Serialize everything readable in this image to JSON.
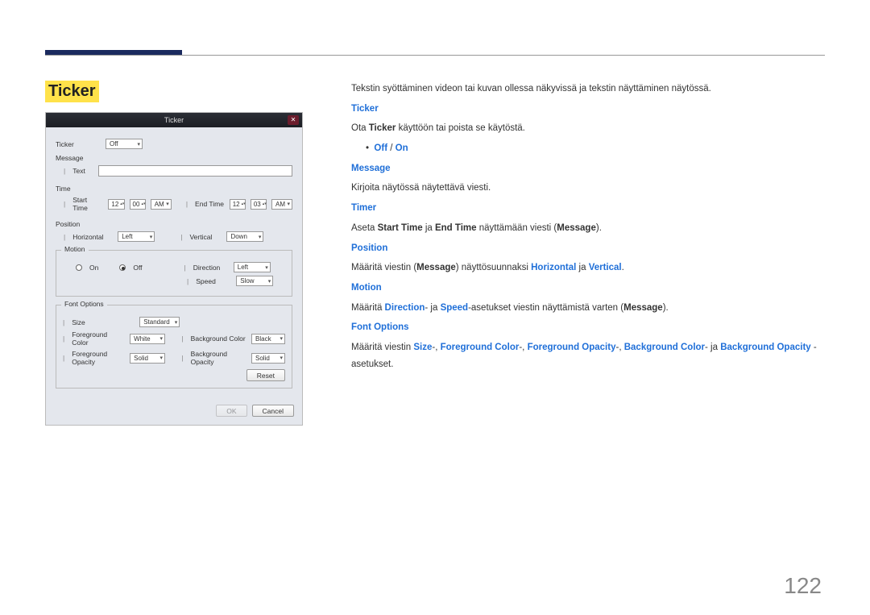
{
  "page_number": "122",
  "heading": "Ticker",
  "intro": "Tekstin syöttäminen videon tai kuvan ollessa näkyvissä ja tekstin näyttäminen näytössä.",
  "sections": {
    "ticker": {
      "title": "Ticker",
      "line1_a": "Ota ",
      "line1_term": "Ticker",
      "line1_b": " käyttöön tai poista se käytöstä.",
      "opt_off": "Off",
      "opt_sep": " / ",
      "opt_on": "On"
    },
    "message": {
      "title": "Message",
      "text": "Kirjoita näytössä näytettävä viesti."
    },
    "timer": {
      "title": "Timer",
      "a": "Aseta ",
      "start": "Start Time",
      "mid": " ja ",
      "end": "End Time",
      "b": " näyttämään viesti (",
      "msg": "Message",
      "c": ")."
    },
    "position": {
      "title": "Position",
      "a": "Määritä viestin (",
      "msg": "Message",
      "b": ") näyttösuunnaksi ",
      "h": "Horizontal",
      "mid": " ja ",
      "v": "Vertical",
      "end": "."
    },
    "motion": {
      "title": "Motion",
      "a": "Määritä ",
      "dir": "Direction",
      "mid1": "- ja ",
      "spd": "Speed",
      "b": "-asetukset viestin näyttämistä varten (",
      "msg": "Message",
      "c": ")."
    },
    "font": {
      "title": "Font Options",
      "a": "Määritä viestin ",
      "size": "Size",
      "s1": "-, ",
      "fg": "Foreground Color",
      "s2": "-, ",
      "fo": "Foreground Opacity",
      "s3": "-, ",
      "bg": "Background Color",
      "s4": "- ja ",
      "bo": "Background Opacity",
      "end": " -asetukset."
    }
  },
  "shot": {
    "title": "Ticker",
    "close": "✕",
    "rows": {
      "ticker_label": "Ticker",
      "ticker_val": "Off",
      "message_label": "Message",
      "message_sub": "Text",
      "time_label": "Time",
      "start_label": "Start Time",
      "end_label": "End Time",
      "h12": "12",
      "m00": "00",
      "m03": "03",
      "am": "AM",
      "position_label": "Position",
      "horiz_label": "Horizontal",
      "horiz_val": "Left",
      "vert_label": "Vertical",
      "vert_val": "Down",
      "motion_label": "Motion",
      "on": "On",
      "off": "Off",
      "direction_label": "Direction",
      "direction_val": "Left",
      "speed_label": "Speed",
      "speed_val": "Slow",
      "font_label": "Font Options",
      "size_label": "Size",
      "size_val": "Standard",
      "fgc_label": "Foreground Color",
      "fgc_val": "White",
      "bgc_label": "Background Color",
      "bgc_val": "Black",
      "fgo_label": "Foreground Opacity",
      "fgo_val": "Solid",
      "bgo_label": "Background Opacity",
      "bgo_val": "Solid",
      "reset": "Reset",
      "ok": "OK",
      "cancel": "Cancel"
    }
  }
}
